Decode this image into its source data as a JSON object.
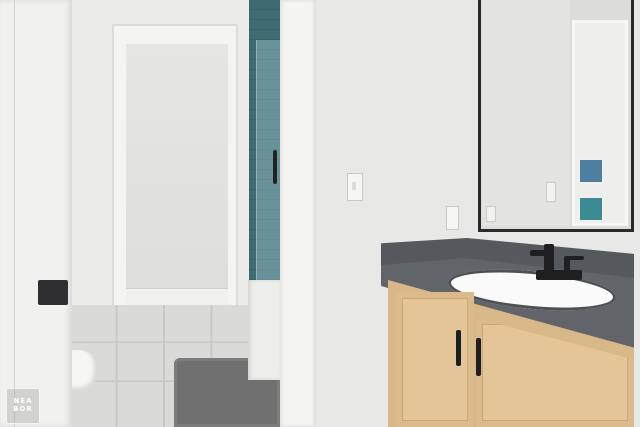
{
  "photo": {
    "subject": "bathroom-vanity-with-mirror",
    "watermark": {
      "line1": "NEA",
      "line2": "BOR"
    },
    "colors": {
      "wall": "#e9e9e7",
      "trim": "#f3f3f1",
      "floor_tile": "#d8d8d6",
      "shower_tile": "#3f6d73",
      "countertop": "#5f6265",
      "cabinet_wood": "#e2c296",
      "faucet": "#1f1f21",
      "bath_mat": "#6e6e6e"
    }
  }
}
